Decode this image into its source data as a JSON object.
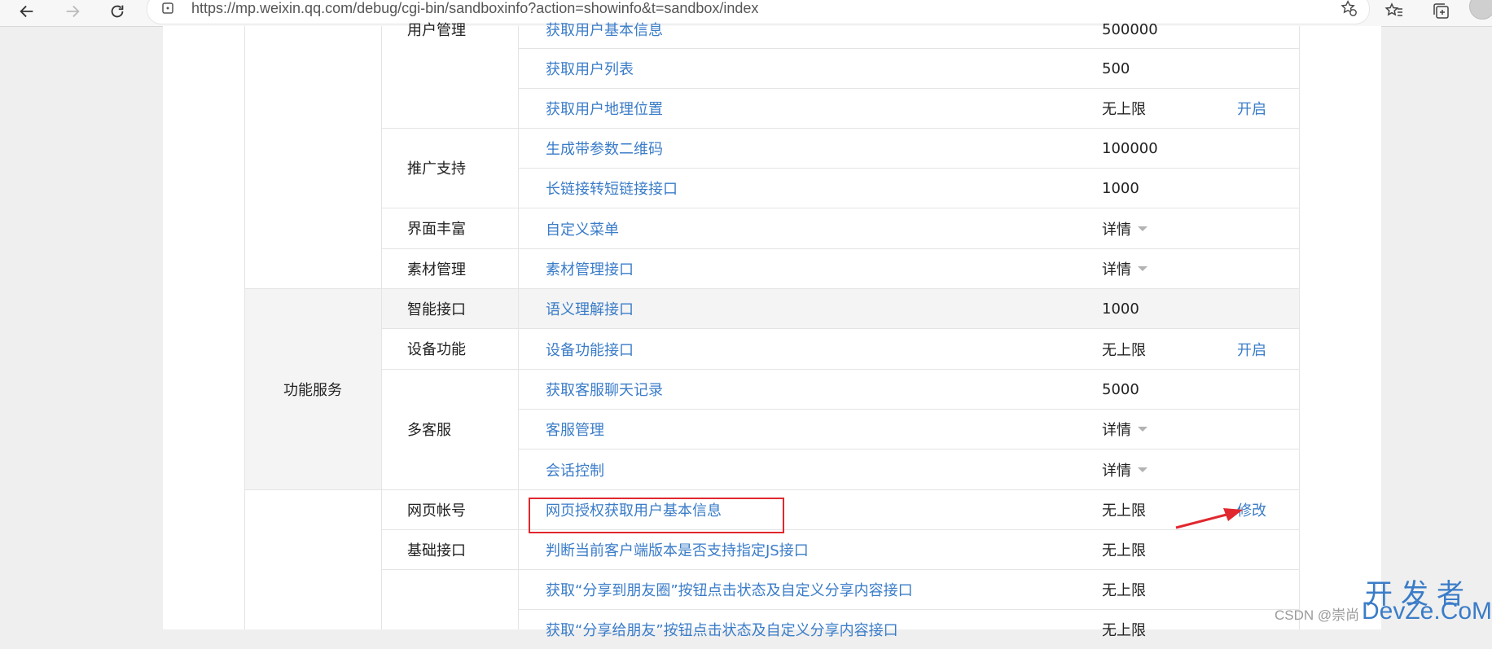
{
  "browser": {
    "url": "https://mp.weixin.qq.com/debug/cgi-bin/sandboxinfo?action=showinfo&t=sandbox/index"
  },
  "table": {
    "categories": [
      {
        "label": ""
      },
      {
        "label": "功能服务"
      },
      {
        "label": ""
      }
    ],
    "groups": [
      {
        "label": "用户管理"
      },
      {
        "label": "推广支持"
      },
      {
        "label": "界面丰富"
      },
      {
        "label": "素材管理"
      },
      {
        "label": "智能接口"
      },
      {
        "label": "设备功能"
      },
      {
        "label": "多客服"
      },
      {
        "label": "网页帐号"
      },
      {
        "label": "基础接口"
      },
      {
        "label": ""
      }
    ],
    "rows": [
      {
        "api": "获取用户基本信息",
        "limit": "500000",
        "action": ""
      },
      {
        "api": "获取用户列表",
        "limit": "500",
        "action": ""
      },
      {
        "api": "获取用户地理位置",
        "limit": "无上限",
        "action": "开启"
      },
      {
        "api": "生成带参数二维码",
        "limit": "100000",
        "action": ""
      },
      {
        "api": "长链接转短链接接口",
        "limit": "1000",
        "action": ""
      },
      {
        "api": "自定义菜单",
        "limit": "详情",
        "action": ""
      },
      {
        "api": "素材管理接口",
        "limit": "详情",
        "action": ""
      },
      {
        "api": "语义理解接口",
        "limit": "1000",
        "action": ""
      },
      {
        "api": "设备功能接口",
        "limit": "无上限",
        "action": "开启"
      },
      {
        "api": "获取客服聊天记录",
        "limit": "5000",
        "action": ""
      },
      {
        "api": "客服管理",
        "limit": "详情",
        "action": ""
      },
      {
        "api": "会话控制",
        "limit": "详情",
        "action": ""
      },
      {
        "api": "网页授权获取用户基本信息",
        "limit": "无上限",
        "action": "修改"
      },
      {
        "api": "判断当前客户端版本是否支持指定JS接口",
        "limit": "无上限",
        "action": ""
      },
      {
        "api": "获取“分享到朋友圈”按钮点击状态及自定义分享内容接口",
        "limit": "无上限",
        "action": ""
      },
      {
        "api": "获取“分享给朋友”按钮点击状态及自定义分享内容接口",
        "limit": "无上限",
        "action": ""
      }
    ]
  },
  "watermark": {
    "csdn": "CSDN @崇尚",
    "devze_cn": "开发者",
    "devze_en": "DevZe.CoM"
  },
  "colors": {
    "link": "#3a7cc8",
    "highlight": "#e0282e",
    "row_hover": "#f4f4f4"
  }
}
